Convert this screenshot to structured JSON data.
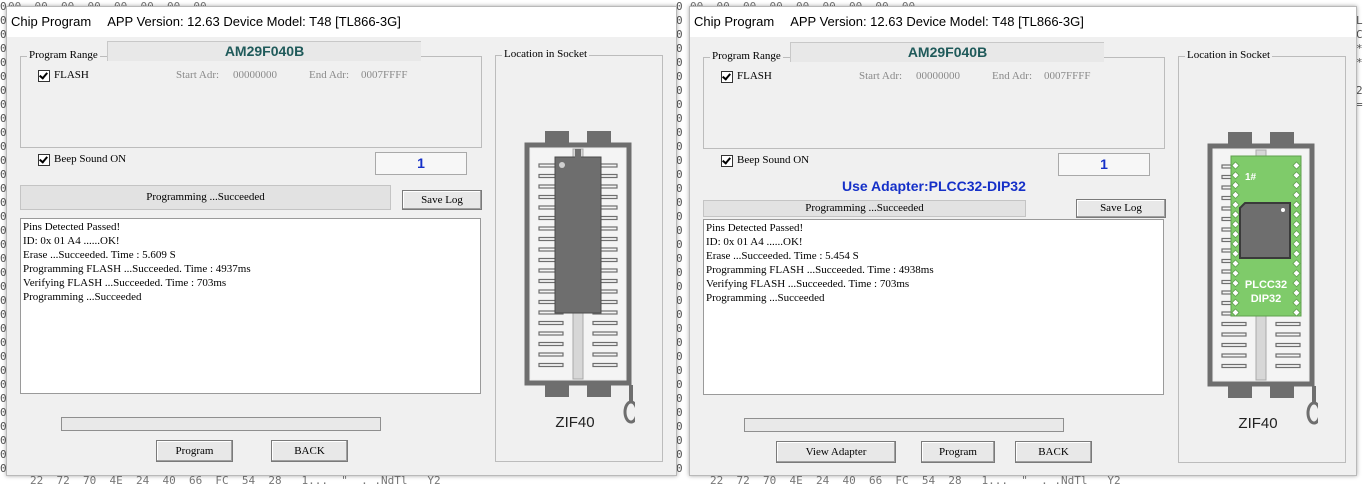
{
  "background": {
    "left_rows": [
      "0",
      "0",
      "0",
      "0",
      "0",
      "0",
      "0",
      "0",
      "0",
      "0",
      "0",
      "0",
      "0",
      "0",
      "0",
      "0",
      "0",
      "0",
      "0",
      "0",
      "0",
      "0",
      "0",
      "0",
      "0",
      "0",
      "0",
      "0",
      "0",
      "0",
      "0",
      "0",
      "0",
      "0"
    ],
    "mid_rows": [
      "0",
      "0",
      "0",
      "0",
      "0",
      "0",
      "0",
      "0",
      "0",
      "0",
      "0",
      "0",
      "0",
      "0",
      "0",
      "0",
      "0",
      "0",
      "0",
      "0",
      "0",
      "0",
      "0",
      "0",
      "0",
      "0",
      "0",
      "0",
      "0",
      "0",
      "0",
      "0",
      "0",
      "0"
    ],
    "right_rows": [
      "",
      "L",
      "C",
      "*",
      "*",
      "",
      "2",
      "=",
      "",
      "",
      "",
      "",
      "",
      "",
      "",
      "",
      "",
      "",
      "",
      "",
      "",
      "",
      "",
      "",
      "",
      "",
      "",
      "",
      "",
      "",
      "",
      "",
      "",
      ""
    ],
    "top_left": "00  00  00  00  00  00  00  00  ",
    "top_right": "00  00  00  00  00  00  00  00  00  ",
    "bottom_left": "22  72  70  4E  24  40  66  FC  54  28   1...  \"  ._.NdTl   Y2",
    "bottom_right": "22  72  70  4E  24  40  66  FC  54  28   1...  \"  ._.NdTl   Y2"
  },
  "colors": {
    "chip_name": "#1f5a5a",
    "count_blue": "#1530c8",
    "adapter_green": "#7fcb6a",
    "socket_gray": "#6e6e6e"
  },
  "windows": [
    {
      "title": "Chip Program",
      "app_info": "APP Version: 12.63 Device Model: T48 [TL866-3G]",
      "program_range_title": "Program Range",
      "chip_name": "AM29F040B",
      "flash_label": "FLASH",
      "start_adr_label": "Start Adr:",
      "start_adr_value": "00000000",
      "end_adr_label": "End Adr:",
      "end_adr_value": "0007FFFF",
      "beep_label": "Beep Sound ON",
      "count": "1",
      "status": "Programming  ...Succeeded",
      "save_log": "Save Log",
      "log_lines": [
        "Pins Detected Passed!",
        "ID: 0x 01 A4 ......OK!",
        "Erase  ...Succeeded. Time : 5.609 S",
        "Programming FLASH ...Succeeded. Time : 4937ms",
        "Verifying FLASH ...Succeeded. Time : 703ms",
        "Programming  ...Succeeded"
      ],
      "location_title": "Location in Socket",
      "socket_label": "ZIF40",
      "program_button": "Program",
      "back_button": "BACK"
    },
    {
      "title": "Chip Program",
      "app_info": "APP Version: 12.63 Device Model: T48 [TL866-3G]",
      "program_range_title": "Program Range",
      "chip_name": "AM29F040B",
      "flash_label": "FLASH",
      "start_adr_label": "Start Adr:",
      "start_adr_value": "00000000",
      "end_adr_label": "End Adr:",
      "end_adr_value": "0007FFFF",
      "beep_label": "Beep Sound ON",
      "count": "1",
      "adapter_notice": "Use Adapter:PLCC32-DIP32",
      "status": "Programming  ...Succeeded",
      "save_log": "Save Log",
      "log_lines": [
        "Pins Detected Passed!",
        "ID: 0x 01 A4 ......OK!",
        "Erase  ...Succeeded. Time : 5.454 S",
        "Programming FLASH ...Succeeded. Time : 4938ms",
        "Verifying FLASH ...Succeeded. Time : 703ms",
        "Programming  ...Succeeded"
      ],
      "location_title": "Location in Socket",
      "adapter_pin1": "1#",
      "adapter_text_1": "PLCC32",
      "adapter_text_2": "DIP32",
      "socket_label": "ZIF40",
      "view_adapter_button": "View Adapter",
      "program_button": "Program",
      "back_button": "BACK"
    }
  ]
}
